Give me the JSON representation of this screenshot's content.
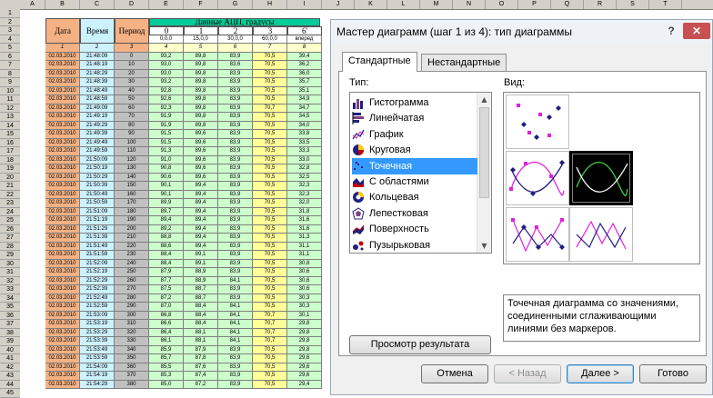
{
  "spreadsheet": {
    "columns": [
      "A",
      "B",
      "C",
      "D",
      "E",
      "F",
      "G",
      "H",
      "I",
      "J",
      "K",
      "L",
      "M",
      "N",
      "O",
      "P",
      "Q",
      "R",
      "S",
      "T"
    ],
    "rows": [
      "1",
      "2",
      "3",
      "4",
      "5",
      "6",
      "7",
      "8",
      "9",
      "10",
      "11",
      "12",
      "13",
      "14",
      "15",
      "16",
      "17",
      "18",
      "19",
      "20",
      "21",
      "22",
      "23",
      "24",
      "25",
      "26",
      "27",
      "28",
      "29",
      "30",
      "31",
      "32",
      "33",
      "34",
      "35",
      "36",
      "37",
      "38",
      "39",
      "40",
      "41",
      "42",
      "43",
      "44",
      "45"
    ],
    "header": {
      "date": "Дата",
      "time": "Время",
      "period": "Период",
      "adc_group": "Данные АЦП, градусы",
      "channels": [
        "0",
        "1",
        "2",
        "3",
        "6'"
      ],
      "channel_sub": [
        "0,0,0",
        "15,0,0",
        "30,0,0",
        "60,0,0",
        "вперед"
      ],
      "index_row": [
        "1",
        "2",
        "3",
        "4",
        "5",
        "6",
        "7",
        "8"
      ]
    },
    "data_rows": [
      [
        "02.03.2010",
        "21:48:09",
        "0",
        "93,2",
        "89,8",
        "83,9",
        "70,5",
        "39,4"
      ],
      [
        "02.03.2010",
        "21:48:19",
        "10",
        "93,0",
        "89,8",
        "83,6",
        "70,5",
        "36,2"
      ],
      [
        "02.03.2010",
        "21:48:29",
        "20",
        "93,0",
        "89,8",
        "83,9",
        "70,5",
        "36,0"
      ],
      [
        "02.03.2010",
        "21:48:39",
        "30",
        "93,2",
        "89,8",
        "83,9",
        "70,5",
        "35,7"
      ],
      [
        "02.03.2010",
        "21:48:49",
        "40",
        "92,8",
        "89,8",
        "83,9",
        "70,5",
        "35,1"
      ],
      [
        "02.03.2010",
        "21:48:59",
        "50",
        "92,6",
        "89,8",
        "83,9",
        "70,5",
        "34,9"
      ],
      [
        "02.03.2010",
        "21:49:09",
        "60",
        "92,3",
        "89,8",
        "83,9",
        "70,7",
        "34,7"
      ],
      [
        "02.03.2010",
        "21:49:19",
        "70",
        "91,9",
        "89,8",
        "83,9",
        "70,5",
        "34,5"
      ],
      [
        "02.03.2010",
        "21:49:29",
        "80",
        "91,9",
        "89,8",
        "83,9",
        "70,5",
        "34,0"
      ],
      [
        "02.03.2010",
        "21:49:39",
        "90",
        "91,5",
        "89,6",
        "83,9",
        "70,5",
        "33,8"
      ],
      [
        "02.03.2010",
        "21:49:49",
        "100",
        "91,5",
        "89,6",
        "83,9",
        "70,5",
        "33,5"
      ],
      [
        "02.03.2010",
        "21:49:59",
        "110",
        "91,3",
        "89,6",
        "83,9",
        "70,5",
        "33,3"
      ],
      [
        "02.03.2010",
        "21:50:09",
        "120",
        "91,0",
        "89,6",
        "83,9",
        "70,5",
        "33,0"
      ],
      [
        "02.03.2010",
        "21:50:19",
        "130",
        "90,8",
        "89,6",
        "83,9",
        "70,5",
        "32,8"
      ],
      [
        "02.03.2010",
        "21:50:29",
        "140",
        "90,6",
        "89,6",
        "83,9",
        "70,5",
        "32,5"
      ],
      [
        "02.03.2010",
        "21:50:39",
        "150",
        "90,1",
        "89,4",
        "83,9",
        "70,5",
        "32,3"
      ],
      [
        "02.03.2010",
        "21:50:49",
        "160",
        "90,1",
        "89,4",
        "83,9",
        "70,5",
        "32,3"
      ],
      [
        "02.03.2010",
        "21:50:59",
        "170",
        "89,9",
        "89,4",
        "83,9",
        "70,5",
        "32,0"
      ],
      [
        "02.03.2010",
        "21:51:09",
        "180",
        "89,7",
        "89,4",
        "83,9",
        "70,5",
        "31,8"
      ],
      [
        "02.03.2010",
        "21:51:19",
        "190",
        "89,4",
        "89,4",
        "83,9",
        "70,5",
        "31,6"
      ],
      [
        "02.03.2010",
        "21:51:29",
        "200",
        "89,2",
        "89,4",
        "83,9",
        "70,5",
        "31,6"
      ],
      [
        "02.03.2010",
        "21:51:39",
        "210",
        "88,8",
        "89,4",
        "83,9",
        "70,5",
        "31,3"
      ],
      [
        "02.03.2010",
        "21:51:49",
        "220",
        "88,6",
        "89,4",
        "83,9",
        "70,5",
        "31,1"
      ],
      [
        "02.03.2010",
        "21:51:59",
        "230",
        "88,4",
        "89,1",
        "83,9",
        "70,5",
        "31,1"
      ],
      [
        "02.03.2010",
        "21:52:09",
        "240",
        "88,4",
        "89,1",
        "83,9",
        "70,5",
        "30,8"
      ],
      [
        "02.03.2010",
        "21:52:19",
        "250",
        "87,9",
        "88,9",
        "83,9",
        "70,5",
        "30,6"
      ],
      [
        "02.03.2010",
        "21:52:29",
        "260",
        "87,7",
        "88,9",
        "84,1",
        "70,5",
        "30,6"
      ],
      [
        "02.03.2010",
        "21:52:39",
        "270",
        "87,5",
        "88,7",
        "83,9",
        "70,5",
        "30,6"
      ],
      [
        "02.03.2010",
        "21:52:49",
        "280",
        "87,2",
        "88,7",
        "83,9",
        "70,5",
        "30,3"
      ],
      [
        "02.03.2010",
        "21:52:59",
        "290",
        "87,0",
        "88,4",
        "84,1",
        "70,5",
        "30,3"
      ],
      [
        "02.03.2010",
        "21:53:09",
        "300",
        "86,8",
        "88,4",
        "84,1",
        "70,7",
        "30,1"
      ],
      [
        "02.03.2010",
        "21:53:19",
        "310",
        "86,6",
        "88,4",
        "84,1",
        "70,7",
        "29,8"
      ],
      [
        "02.03.2010",
        "21:53:29",
        "320",
        "86,4",
        "88,1",
        "84,1",
        "70,7",
        "29,8"
      ],
      [
        "02.03.2010",
        "21:53:39",
        "330",
        "86,1",
        "88,1",
        "84,1",
        "70,7",
        "29,8"
      ],
      [
        "02.03.2010",
        "21:53:49",
        "340",
        "85,9",
        "87,9",
        "83,9",
        "70,5",
        "29,8"
      ],
      [
        "02.03.2010",
        "21:53:59",
        "350",
        "85,7",
        "87,8",
        "83,9",
        "70,5",
        "29,6"
      ],
      [
        "02.03.2010",
        "21:54:09",
        "360",
        "85,5",
        "87,6",
        "83,9",
        "70,5",
        "29,6"
      ],
      [
        "02.03.2010",
        "21:54:19",
        "370",
        "85,3",
        "87,4",
        "83,9",
        "70,5",
        "29,6"
      ],
      [
        "02.03.2010",
        "21:54:29",
        "380",
        "85,0",
        "87,2",
        "83,9",
        "70,5",
        "29,4"
      ],
      [
        "02.03.2010",
        "21:54:39",
        "390",
        "84,6",
        "87,2",
        "84,1",
        "70,5",
        "29,4"
      ]
    ]
  },
  "dialog": {
    "title": "Мастер диаграмм (шаг 1 из 4): тип диаграммы",
    "help": "?",
    "close": "✕",
    "tabs": [
      "Стандартные",
      "Нестандартные"
    ],
    "type_label": "Тип:",
    "view_label": "Вид:",
    "chart_types": [
      {
        "label": "Гистограмма",
        "icon": "column-chart-icon"
      },
      {
        "label": "Линейчатая",
        "icon": "bar-chart-icon"
      },
      {
        "label": "График",
        "icon": "line-chart-icon"
      },
      {
        "label": "Круговая",
        "icon": "pie-chart-icon"
      },
      {
        "label": "Точечная",
        "icon": "scatter-chart-icon"
      },
      {
        "label": "С областями",
        "icon": "area-chart-icon"
      },
      {
        "label": "Кольцевая",
        "icon": "doughnut-chart-icon"
      },
      {
        "label": "Лепестковая",
        "icon": "radar-chart-icon"
      },
      {
        "label": "Поверхность",
        "icon": "surface-chart-icon"
      },
      {
        "label": "Пузырьковая",
        "icon": "bubble-chart-icon"
      }
    ],
    "selected_type": "Точечная",
    "description": "Точечная диаграмма со значениями, соединенными сглаживающими линиями без маркеров.",
    "preview_button": "Просмотр результата",
    "buttons": {
      "cancel": "Отмена",
      "back": "< Назад",
      "next": "Далее >",
      "finish": "Готово"
    },
    "colors": {
      "accent": "#3399ff",
      "series_magenta": "#e020e0",
      "series_navy": "#202080",
      "selected_subtype_bg": "#000000",
      "series_green": "#40d040"
    }
  }
}
